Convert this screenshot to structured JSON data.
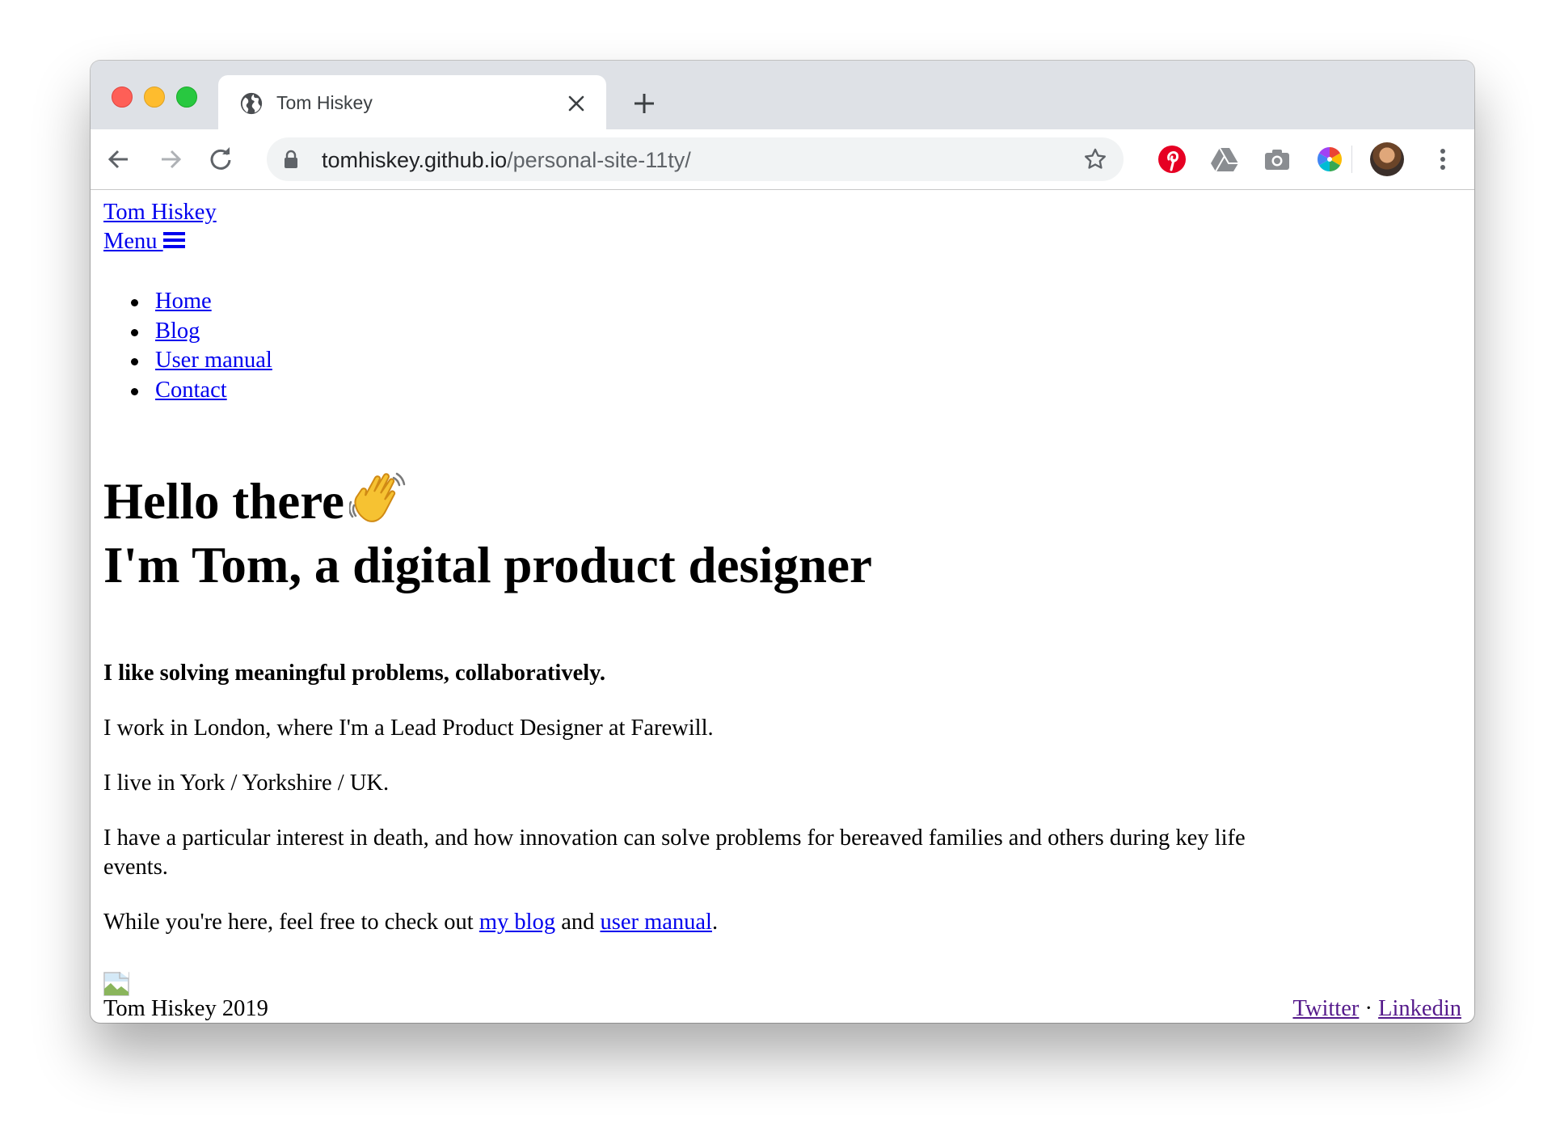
{
  "browser": {
    "tab_title": "Tom Hiskey",
    "url_host": "tomhiskey.github.io",
    "url_path": "/personal-site-11ty/"
  },
  "site": {
    "brand": "Tom Hiskey",
    "menu_label": "Menu",
    "nav": [
      "Home",
      "Blog",
      "User manual",
      "Contact"
    ],
    "heading_line1": "Hello there",
    "heading_line2": "I'm Tom, a digital product designer",
    "tagline": "I like solving meaningful problems, collaboratively.",
    "para_work": "I work in London, where I'm a Lead Product Designer at Farewill.",
    "para_live": "I live in York / Yorkshire / UK.",
    "para_interest_1": "I have a particular interest in death, and how innovation can solve problems for bereaved families and others during key life",
    "para_interest_2": "events.",
    "para_links_prefix": "While you're here, feel free to check out ",
    "link_blog": "my blog",
    "para_links_and": " and ",
    "link_manual": "user manual",
    "para_links_suffix": ".",
    "footer_copyright": "Tom Hiskey 2019",
    "footer_twitter": "Twitter",
    "footer_dot": " · ",
    "footer_linkedin": "Linkedin"
  },
  "icons": {
    "tab": "globe-icon",
    "toolbar": [
      "back-arrow-icon",
      "forward-arrow-icon",
      "reload-icon",
      "lock-icon",
      "star-icon"
    ],
    "extensions": [
      "pinterest-icon",
      "google-drive-icon",
      "camera-icon",
      "color-wheel-icon",
      "avatar",
      "more-vert-icon"
    ],
    "menu": "hamburger-icon",
    "heading": "waving-hand-emoji"
  },
  "colors": {
    "link": "#0000ee",
    "visited_link": "#551a8b",
    "tabstrip": "#dee1e6",
    "omnibox": "#f1f3f4",
    "pinterest": "#e60023"
  }
}
